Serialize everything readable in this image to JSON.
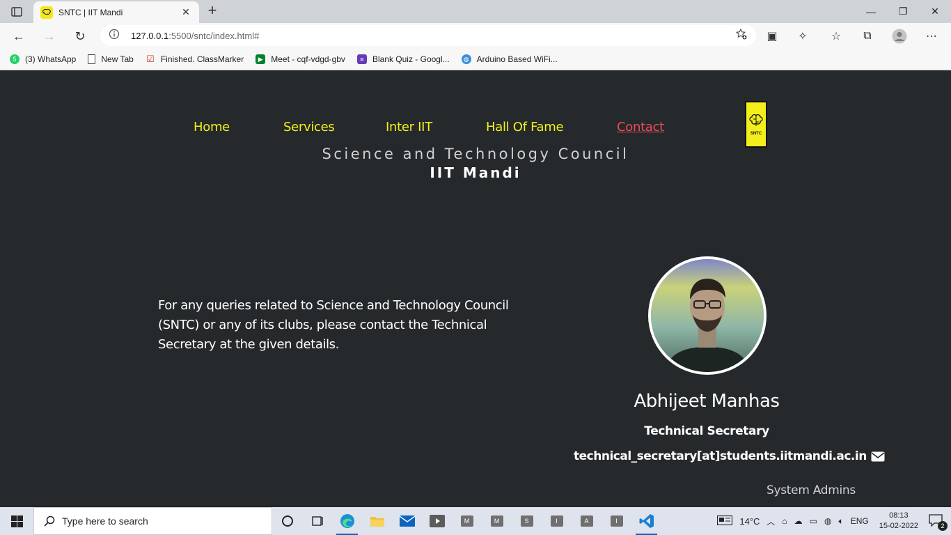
{
  "browser": {
    "tab_title": "SNTC | IIT Mandi",
    "url_host": "127.0.0.1",
    "url_path": ":5500/sntc/index.html#",
    "bookmarks": [
      {
        "label": "(3) WhatsApp",
        "icon": "whatsapp-icon",
        "color": "#25d366"
      },
      {
        "label": "New Tab",
        "icon": "page-icon",
        "color": "#ffffff"
      },
      {
        "label": "Finished. ClassMarker",
        "icon": "checkmark-icon",
        "color": "#d9342b"
      },
      {
        "label": "Meet - cqf-vdgd-gbv",
        "icon": "meet-icon",
        "color": "#00832d"
      },
      {
        "label": "Blank Quiz - Googl...",
        "icon": "forms-icon",
        "color": "#673ab7"
      },
      {
        "label": "Arduino Based WiFi...",
        "icon": "globe-icon",
        "color": "#3a8dde"
      }
    ]
  },
  "site": {
    "nav": {
      "home": "Home",
      "services": "Services",
      "inter_iit": "Inter IIT",
      "hall_of_fame": "Hall Of Fame",
      "contact": "Contact"
    },
    "logo_text": "SNTC",
    "council": "Science and Technology Council",
    "institute": "IIT Mandi",
    "query_text": "For any queries related to Science and Technology Council (SNTC) or any of its clubs, please contact the Technical Secretary at the given details.",
    "contact": {
      "name": "Abhijeet Manhas",
      "role": "Technical Secretary",
      "email": "technical_secretary[at]students.iitmandi.ac.in"
    },
    "system_admins": "System Admins"
  },
  "taskbar": {
    "search_placeholder": "Type here to search",
    "apps": [
      "M",
      "M",
      "S",
      "I",
      "A",
      "I"
    ],
    "weather": "14°C",
    "language": "ENG",
    "time": "08:13",
    "date": "15-02-2022",
    "notifications": "2"
  },
  "colors": {
    "accent_yellow": "#f4ef1b",
    "contact_red": "#ee4a5a",
    "page_bg": "#25292c"
  }
}
